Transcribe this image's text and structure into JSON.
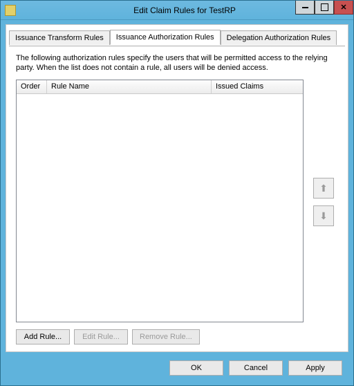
{
  "window": {
    "title": "Edit Claim Rules for TestRP"
  },
  "tabs": {
    "transform": "Issuance Transform Rules",
    "authorization": "Issuance Authorization Rules",
    "delegation": "Delegation Authorization Rules"
  },
  "body": {
    "description": "The following authorization rules specify the users that will be permitted access to the relying party. When the list does not contain a rule, all users will be denied access."
  },
  "columns": {
    "order": "Order",
    "rule_name": "Rule Name",
    "issued_claims": "Issued Claims"
  },
  "buttons": {
    "add_rule": "Add Rule...",
    "edit_rule": "Edit Rule...",
    "remove_rule": "Remove Rule...",
    "ok": "OK",
    "cancel": "Cancel",
    "apply": "Apply"
  }
}
